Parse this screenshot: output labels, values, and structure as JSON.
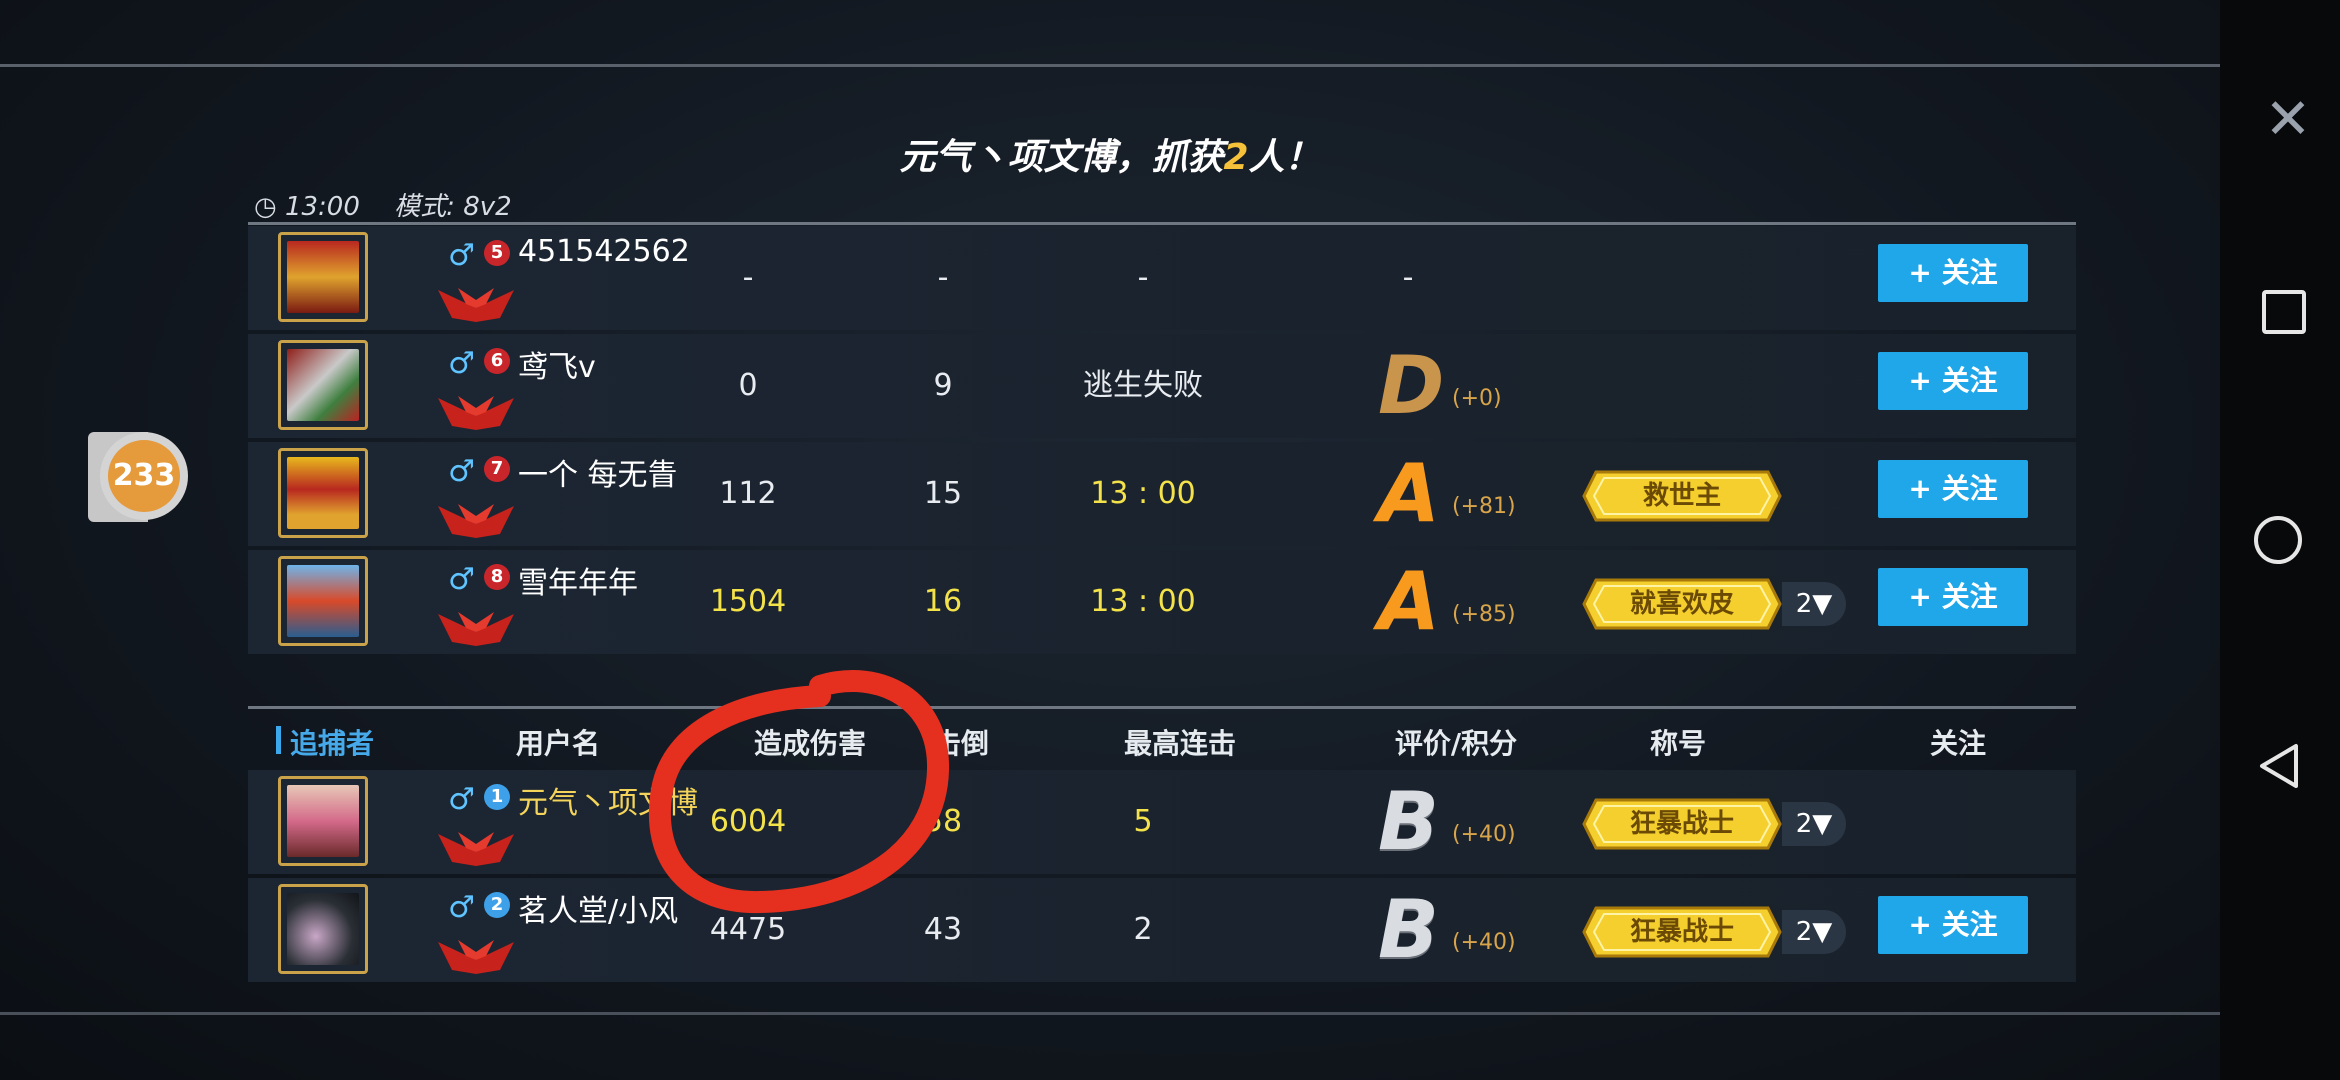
{
  "banner": {
    "prefix": "元气丶项文博，抓获",
    "count": "2",
    "suffix": "人！"
  },
  "match": {
    "time": "13:00",
    "mode_label": "模式:",
    "mode": "8v2"
  },
  "float_badge": {
    "count": "233"
  },
  "colors": {
    "follow": "#1fa7ea",
    "highlight": "#f6c23a",
    "annotation": "#e5301f"
  },
  "runners": [
    {
      "rank": "5",
      "gender": "♂",
      "name": "451542562",
      "damage": "-",
      "hits": "-",
      "time": "-",
      "grade": "",
      "points": "",
      "grade_dash": "-",
      "title": "",
      "extra": "",
      "follow": "+ 关注"
    },
    {
      "rank": "6",
      "gender": "♂",
      "name": "鸢飞v",
      "damage": "0",
      "hits": "9",
      "time": "逃生失败",
      "grade": "D",
      "points": "(+0)",
      "title": "",
      "extra": "",
      "follow": "+ 关注"
    },
    {
      "rank": "7",
      "gender": "♂",
      "name": "一个 每无眚",
      "damage": "112",
      "hits": "15",
      "time": "13 : 00",
      "grade": "A",
      "points": "(+81)",
      "title": "救世主",
      "extra": "",
      "follow": "+ 关注"
    },
    {
      "rank": "8",
      "gender": "♂",
      "name": "雪年年年",
      "damage": "1504",
      "hits": "16",
      "time": "13 : 00",
      "grade": "A",
      "points": "(+85)",
      "title": "就喜欢皮",
      "extra": "2▼",
      "follow": "+ 关注"
    }
  ],
  "chaser_header": {
    "role": "追捕者",
    "username": "用户名",
    "damage": "造成伤害",
    "knockdowns": "击倒",
    "streak": "最高连击",
    "grade": "评价/积分",
    "title": "称号",
    "follow": "关注"
  },
  "chasers": [
    {
      "rank": "1",
      "gender": "♂",
      "name": "元气丶项文博",
      "damage": "6004",
      "hits": "58",
      "streak": "5",
      "grade": "B",
      "points": "(+40)",
      "title": "狂暴战士",
      "extra": "2▼"
    },
    {
      "rank": "2",
      "gender": "♂",
      "name": "茗人堂/小风",
      "damage": "4475",
      "hits": "43",
      "streak": "2",
      "grade": "B",
      "points": "(+40)",
      "title": "狂暴战士",
      "extra": "2▼",
      "follow": "+ 关注"
    }
  ],
  "nav": {
    "close_icon": "close-icon",
    "recents_icon": "square-icon",
    "home_icon": "circle-icon",
    "back_icon": "triangle-icon"
  }
}
